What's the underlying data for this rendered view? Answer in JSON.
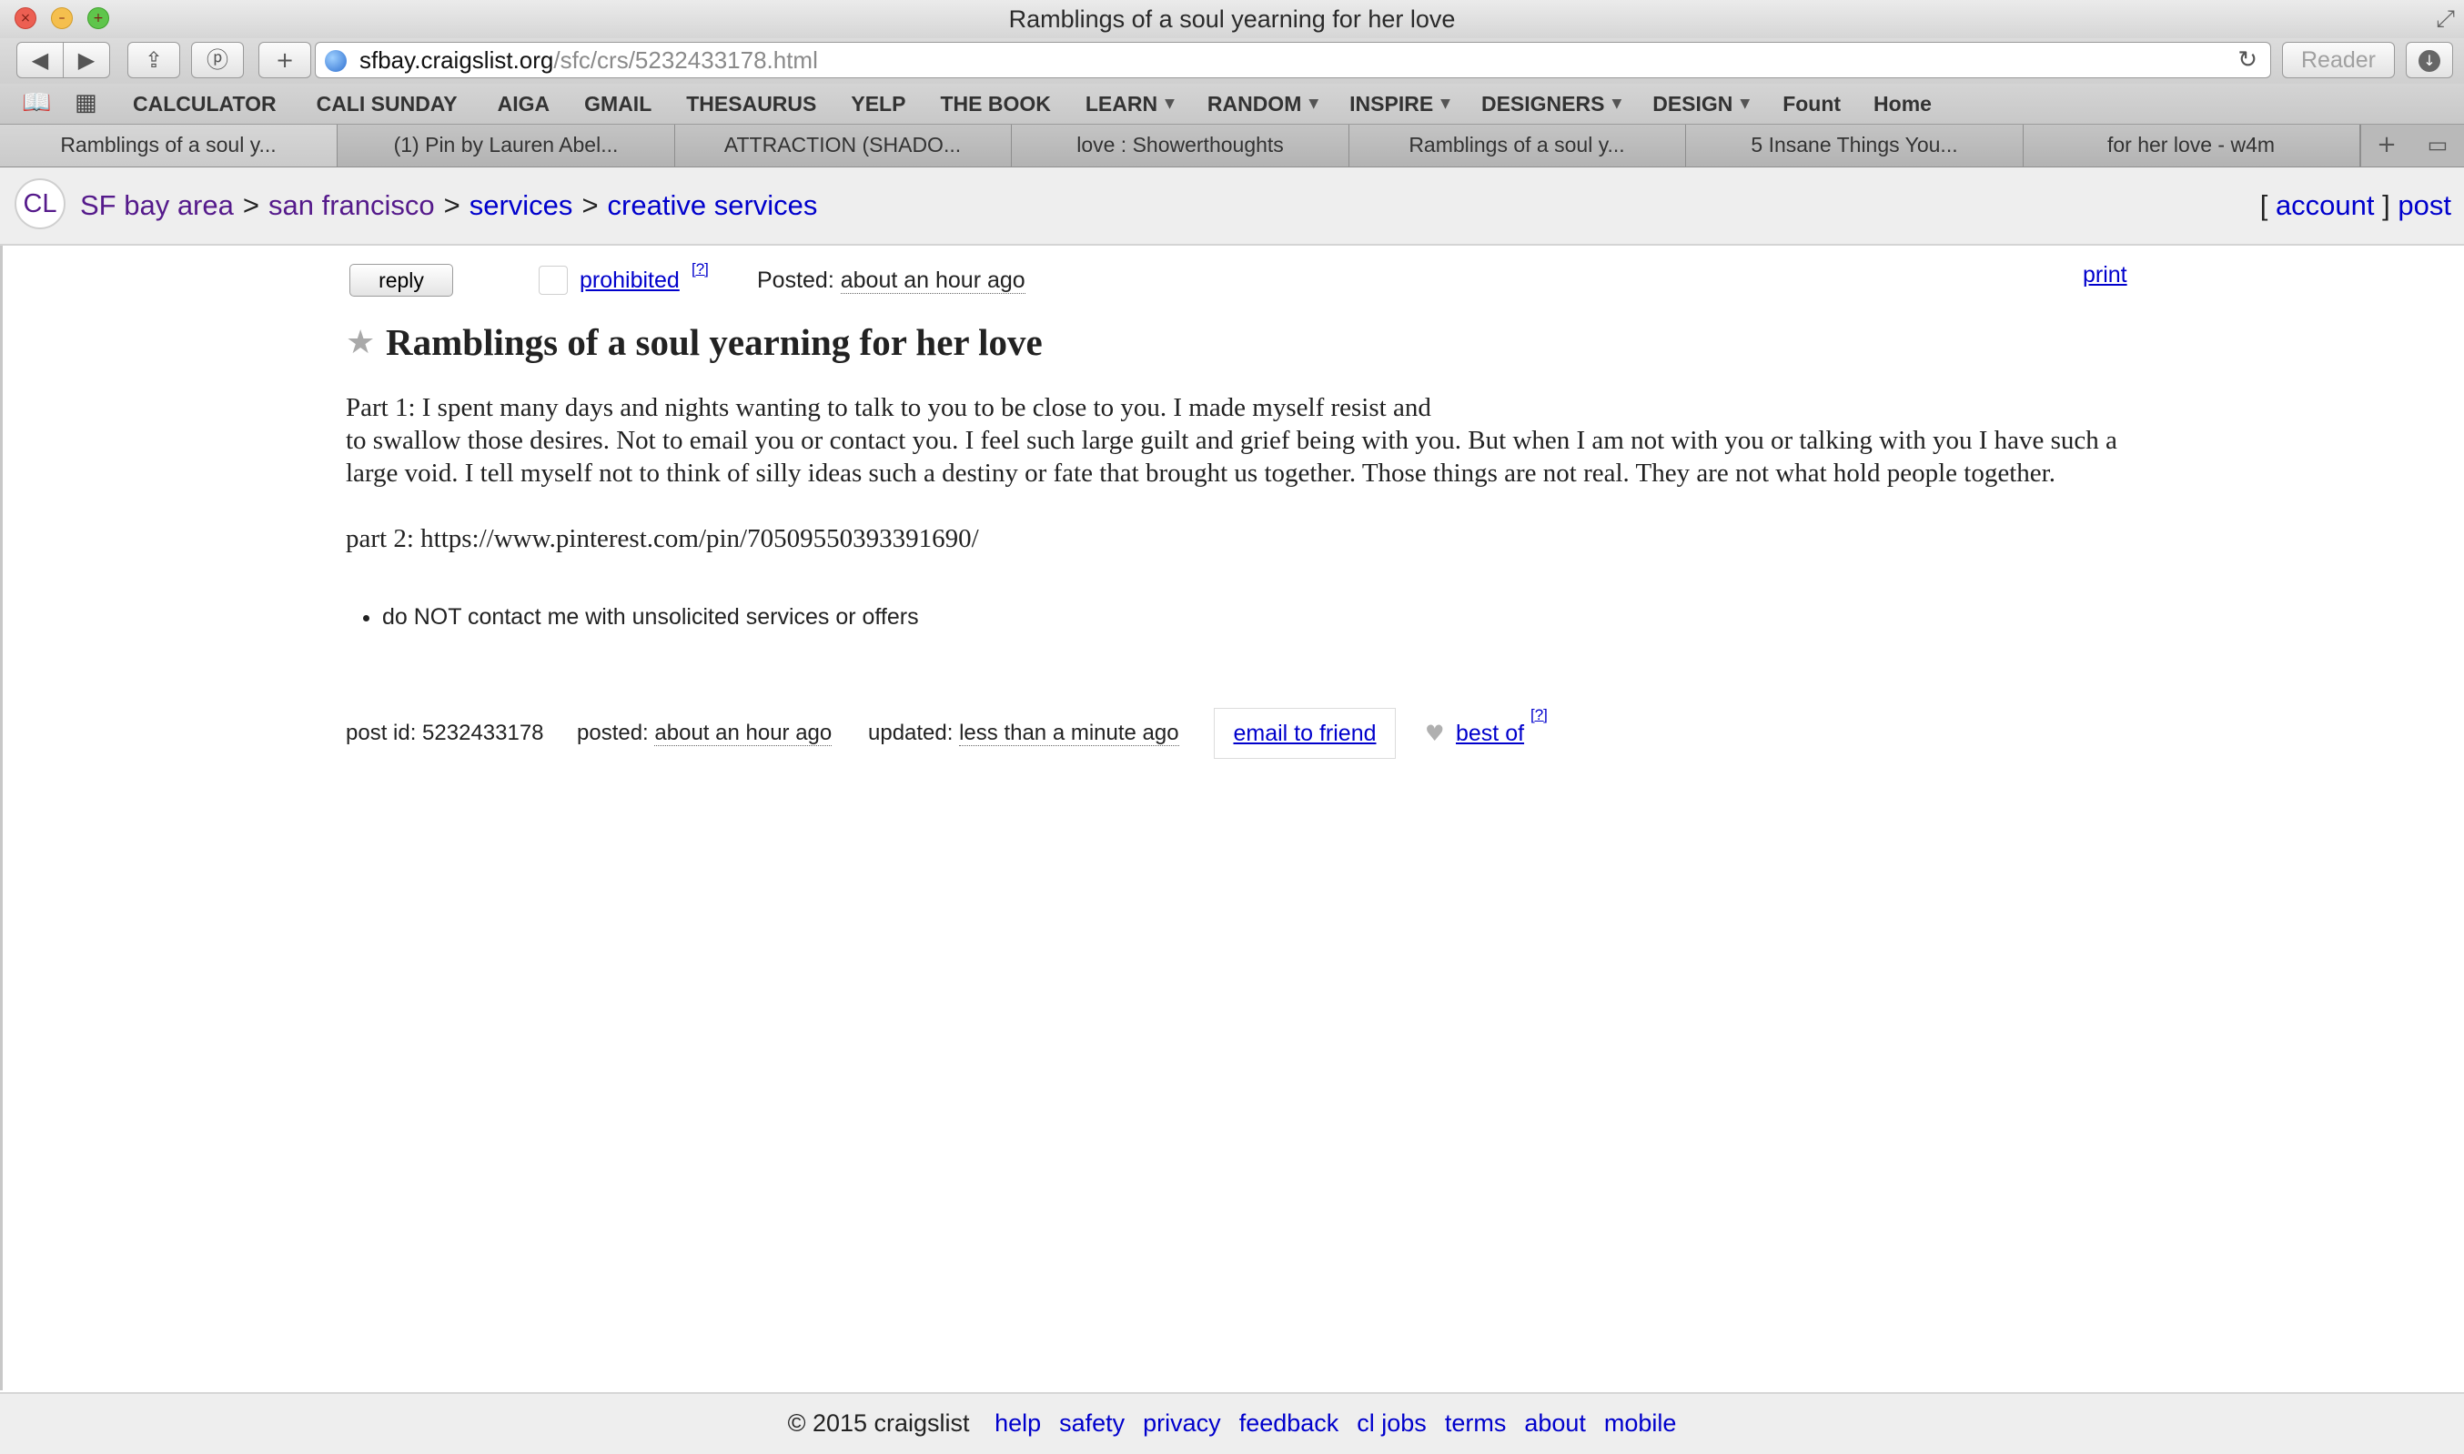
{
  "window": {
    "title": "Ramblings of a soul yearning for her love"
  },
  "toolbar": {
    "url_domain": "sfbay.craigslist.org",
    "url_path": "/sfc/crs/5232433178.html",
    "reader_label": "Reader"
  },
  "bookmarks": [
    {
      "label": "CALCULATOR",
      "dropdown": false
    },
    {
      "label": "CALI SUNDAY",
      "dropdown": false
    },
    {
      "label": "AIGA",
      "dropdown": false
    },
    {
      "label": "GMAIL",
      "dropdown": false
    },
    {
      "label": "THESAURUS",
      "dropdown": false
    },
    {
      "label": "YELP",
      "dropdown": false
    },
    {
      "label": "THE BOOK",
      "dropdown": false
    },
    {
      "label": "LEARN",
      "dropdown": true
    },
    {
      "label": "RANDOM",
      "dropdown": true
    },
    {
      "label": "INSPIRE",
      "dropdown": true
    },
    {
      "label": "DESIGNERS",
      "dropdown": true
    },
    {
      "label": "DESIGN",
      "dropdown": true
    },
    {
      "label": "Fount",
      "dropdown": false
    },
    {
      "label": "Home",
      "dropdown": false
    }
  ],
  "tabs": [
    {
      "label": "Ramblings of a soul y...",
      "active": true
    },
    {
      "label": "(1) Pin by Lauren Abel...",
      "active": false
    },
    {
      "label": "ATTRACTION (SHADO...",
      "active": false
    },
    {
      "label": "love : Showerthoughts",
      "active": false
    },
    {
      "label": "Ramblings of a soul y...",
      "active": false
    },
    {
      "label": "5 Insane Things You...",
      "active": false
    },
    {
      "label": "for her love - w4m",
      "active": false
    }
  ],
  "header": {
    "logo": "CL",
    "breadcrumbs": {
      "area": "SF bay area",
      "sep1": ">",
      "city": "san francisco",
      "sep2": ">",
      "category": "services",
      "sep3": ">",
      "subcategory": "creative services"
    },
    "user": {
      "open_bracket": "[",
      "account": "account",
      "close_bracket": "]",
      "post": "post"
    }
  },
  "post": {
    "reply_label": "reply",
    "prohibited_label": "prohibited",
    "help_mark": "[?]",
    "posted_prefix": "Posted:",
    "posted_value": "about an hour ago",
    "print_label": "print",
    "title": "Ramblings of a soul yearning for her love",
    "body_line1": "Part 1: I spent many days and nights wanting to talk to you to be close to you. I made myself resist and",
    "body_line2": "to swallow those desires. Not to email you or contact you. I feel such large guilt and grief being with you. But when I am not with you or talking with you I have such a large void. I tell myself not to think of silly ideas such a destiny or fate that brought us together. Those things are not real. They are not what hold people together.",
    "body_part2": "part 2: https://www.pinterest.com/pin/70509550393391690/",
    "notice": "do NOT contact me with unsolicited services or offers"
  },
  "postinfo": {
    "id_label": "post id: 5232433178",
    "posted_label": "posted:",
    "posted_value": "about an hour ago",
    "updated_label": "updated:",
    "updated_value": "less than a minute ago",
    "email_label": "email to friend",
    "bestof_label": "best of",
    "help_mark": "[?]"
  },
  "footer": {
    "copyright": "© 2015 craigslist",
    "links": [
      "help",
      "safety",
      "privacy",
      "feedback",
      "cl jobs",
      "terms",
      "about",
      "mobile"
    ]
  }
}
